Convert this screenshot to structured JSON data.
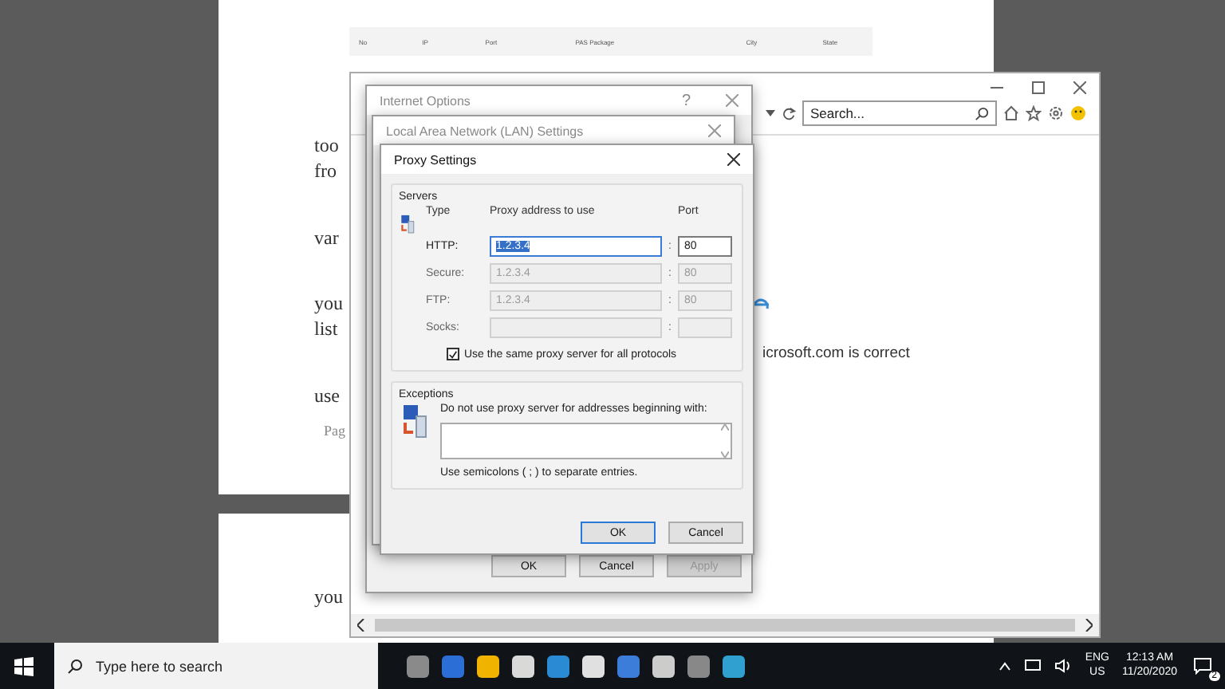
{
  "document": {
    "table_columns": [
      "No",
      "IP",
      "Port",
      "PAS Package",
      "City",
      "State"
    ],
    "fragments": [
      "too",
      "fro",
      "var",
      "you",
      "list",
      "use"
    ],
    "page_label": "Pag",
    "lower_fragment": "you"
  },
  "browser": {
    "search": {
      "placeholder": "Search..."
    },
    "content_text": "icrosoft.com is correct"
  },
  "internet_options": {
    "title": "Internet Options",
    "help": "?",
    "buttons": [
      {
        "label": "OK",
        "disabled": false
      },
      {
        "label": "Cancel",
        "disabled": false
      },
      {
        "label": "Apply",
        "disabled": true
      }
    ]
  },
  "lan_settings": {
    "title": "Local Area Network (LAN) Settings"
  },
  "proxy_settings": {
    "title": "Proxy Settings",
    "servers": {
      "label": "Servers",
      "headers": [
        "Type",
        "Proxy address to use",
        "Port"
      ],
      "separator": ":",
      "rows": [
        {
          "type": "HTTP:",
          "address": "1.2.3.4",
          "port": "80",
          "disabled": false,
          "selected": true
        },
        {
          "type": "Secure:",
          "address": "1.2.3.4",
          "port": "80",
          "disabled": true,
          "selected": false
        },
        {
          "type": "FTP:",
          "address": "1.2.3.4",
          "port": "80",
          "disabled": true,
          "selected": false
        },
        {
          "type": "Socks:",
          "disabled": true
        }
      ],
      "same_proxy": {
        "label": "Use the same proxy server for all protocols",
        "checked": true
      }
    },
    "exceptions": {
      "label": "Exceptions",
      "prompt": "Do not use proxy server for addresses beginning with:",
      "note": "Use semicolons ( ; ) to separate entries."
    },
    "buttons": [
      {
        "label": "OK",
        "default": true
      },
      {
        "label": "Cancel",
        "default": false
      }
    ]
  },
  "taskbar": {
    "search_placeholder": "Type here to search",
    "language": "ENG",
    "region": "US",
    "time": "12:13 AM",
    "date": "11/20/2020",
    "notifications": "2"
  }
}
